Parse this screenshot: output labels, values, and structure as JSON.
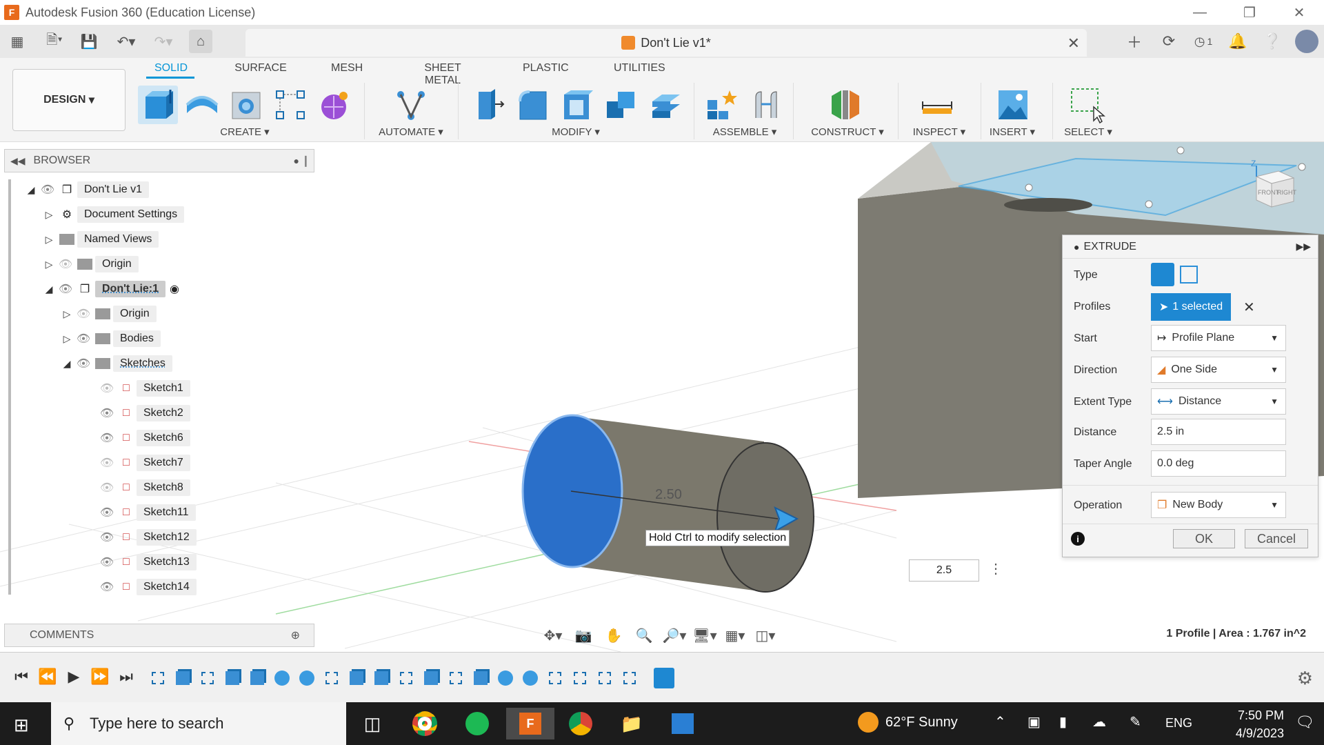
{
  "app": {
    "window_title": "Autodesk Fusion 360 (Education License)",
    "document_title": "Don't Lie v1*",
    "notifications_count": "1"
  },
  "toolbar": {
    "workspace": "DESIGN",
    "tabs": [
      "SOLID",
      "SURFACE",
      "MESH",
      "SHEET METAL",
      "PLASTIC",
      "UTILITIES"
    ],
    "active_tab": "SOLID",
    "groups": [
      "CREATE",
      "AUTOMATE",
      "MODIFY",
      "ASSEMBLE",
      "CONSTRUCT",
      "INSPECT",
      "INSERT",
      "SELECT"
    ]
  },
  "browser": {
    "title": "BROWSER",
    "items": [
      {
        "label": "Don't Lie v1",
        "level": 0,
        "expanded": true
      },
      {
        "label": "Document Settings",
        "level": 1,
        "expanded": false
      },
      {
        "label": "Named Views",
        "level": 1,
        "expanded": false
      },
      {
        "label": "Origin",
        "level": 1,
        "expanded": false
      },
      {
        "label": "Don't Lie:1",
        "level": 1,
        "expanded": true,
        "active": true
      },
      {
        "label": "Origin",
        "level": 2,
        "expanded": false
      },
      {
        "label": "Bodies",
        "level": 2,
        "expanded": false
      },
      {
        "label": "Sketches",
        "level": 2,
        "expanded": true
      },
      {
        "label": "Sketch1",
        "level": 3,
        "hidden": true
      },
      {
        "label": "Sketch2",
        "level": 3
      },
      {
        "label": "Sketch6",
        "level": 3
      },
      {
        "label": "Sketch7",
        "level": 3,
        "hidden": true
      },
      {
        "label": "Sketch8",
        "level": 3,
        "hidden": true
      },
      {
        "label": "Sketch11",
        "level": 3
      },
      {
        "label": "Sketch12",
        "level": 3
      },
      {
        "label": "Sketch13",
        "level": 3
      },
      {
        "label": "Sketch14",
        "level": 3
      }
    ]
  },
  "comments": {
    "title": "COMMENTS"
  },
  "extrude": {
    "title": "EXTRUDE",
    "type_label": "Type",
    "profiles_label": "Profiles",
    "profiles_value": "1 selected",
    "start_label": "Start",
    "start_value": "Profile Plane",
    "direction_label": "Direction",
    "direction_value": "One Side",
    "extent_label": "Extent Type",
    "extent_value": "Distance",
    "distance_label": "Distance",
    "distance_value": "2.5 in",
    "taper_label": "Taper Angle",
    "taper_value": "0.0 deg",
    "operation_label": "Operation",
    "operation_value": "New Body",
    "ok": "OK",
    "cancel": "Cancel"
  },
  "viewport": {
    "tooltip": "Hold Ctrl to modify selection",
    "dimension_label": "2.50",
    "distance_input": "2.5",
    "status": "1 Profile | Area : 1.767 in^2",
    "viewcube_front": "FRONT",
    "viewcube_right": "RIGHT",
    "axis_z": "Z"
  },
  "taskbar": {
    "search_placeholder": "Type here to search",
    "weather": "62°F  Sunny",
    "language": "ENG",
    "time": "7:50 PM",
    "date": "4/9/2023"
  },
  "colors": {
    "accent": "#0696d7",
    "body_blue": "#2a6fc9",
    "body_grey": "#7d7b72"
  }
}
